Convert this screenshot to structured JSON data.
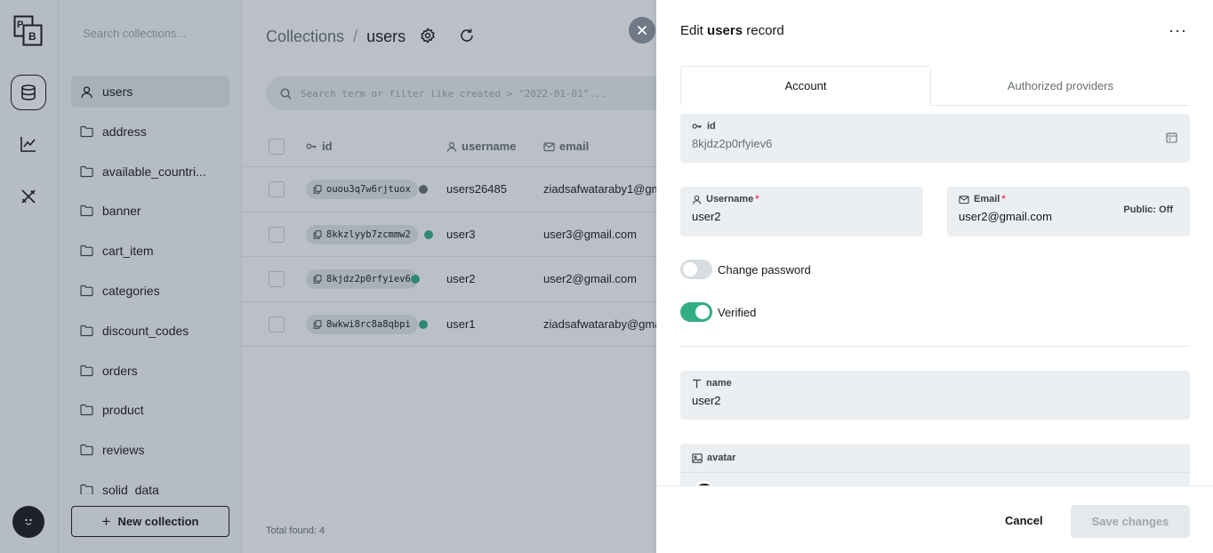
{
  "app": {
    "logo_text": "PB"
  },
  "rail": {
    "items": [
      {
        "icon": "database-icon",
        "active": true
      },
      {
        "icon": "chart-line-icon",
        "active": false
      },
      {
        "icon": "tools-icon",
        "active": false
      }
    ]
  },
  "sidebar": {
    "search_placeholder": "Search collections...",
    "items": [
      {
        "label": "users",
        "icon": "user-icon",
        "active": true
      },
      {
        "label": "address",
        "icon": "folder-icon"
      },
      {
        "label": "available_countri...",
        "icon": "folder-icon"
      },
      {
        "label": "banner",
        "icon": "folder-icon"
      },
      {
        "label": "cart_item",
        "icon": "folder-icon"
      },
      {
        "label": "categories",
        "icon": "folder-icon"
      },
      {
        "label": "discount_codes",
        "icon": "folder-icon"
      },
      {
        "label": "orders",
        "icon": "folder-icon"
      },
      {
        "label": "product",
        "icon": "folder-icon"
      },
      {
        "label": "reviews",
        "icon": "folder-icon"
      },
      {
        "label": "solid_data",
        "icon": "folder-icon"
      }
    ],
    "new_collection_label": "New collection"
  },
  "header": {
    "crumb_root": "Collections",
    "crumb_sep": "/",
    "crumb_current": "users"
  },
  "search": {
    "placeholder": "Search term or filter like created > \"2022-01-01\"..."
  },
  "table": {
    "columns": {
      "id": "id",
      "username": "username",
      "email": "email"
    },
    "rows": [
      {
        "id": "ouou3q7w6rjtuox",
        "verified": false,
        "username": "users26485",
        "email": "ziadsafwataraby1@gmail.com"
      },
      {
        "id": "8kkzlyyb7zcmmw2",
        "verified": true,
        "username": "user3",
        "email": "user3@gmail.com"
      },
      {
        "id": "8kjdz2p0rfyiev6",
        "verified": true,
        "username": "user2",
        "email": "user2@gmail.com"
      },
      {
        "id": "8wkwi8rc8a8qbpi",
        "verified": true,
        "username": "user1",
        "email": "ziadsafwataraby@gmail.com"
      }
    ],
    "total_label": "Total found:",
    "total_value": "4"
  },
  "panel": {
    "title_prefix": "Edit",
    "title_collection": "users",
    "title_suffix": "record",
    "more_label": "···",
    "tabs": {
      "account": "Account",
      "providers": "Authorized providers"
    },
    "fields": {
      "id": {
        "label": "id",
        "value": "8kjdz2p0rfyiev6"
      },
      "username": {
        "label": "Username",
        "required": "*",
        "value": "user2"
      },
      "email": {
        "label": "Email",
        "required": "*",
        "value": "user2@gmail.com",
        "public": "Public: Off"
      },
      "name": {
        "label": "name",
        "value": "user2"
      },
      "avatar": {
        "label": "avatar"
      }
    },
    "change_password_label": "Change password",
    "change_password_on": false,
    "verified_label": "Verified",
    "verified_on": true,
    "cancel_label": "Cancel",
    "save_label": "Save changes"
  },
  "colors": {
    "accent_green": "#32ad84",
    "toggle_off": "#d7dde1",
    "dark": "#16161a"
  }
}
